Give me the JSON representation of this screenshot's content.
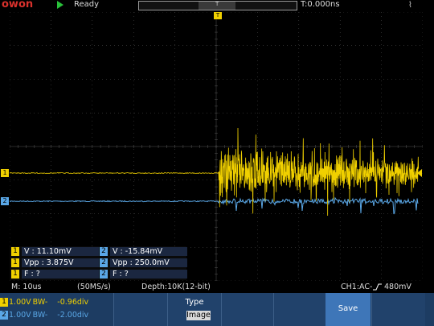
{
  "header": {
    "brand": "owon",
    "status": "Ready",
    "trigger_time": "T:0.000ns",
    "trigger_mark": "T",
    "usb_symbol": "⌇"
  },
  "markers": {
    "ch1": "1",
    "ch2": "2",
    "trigger_top": "T"
  },
  "measurements": [
    {
      "channel": "1",
      "text": "V : 11.10mV"
    },
    {
      "channel": "2",
      "text": "V : -15.84mV"
    },
    {
      "channel": "1",
      "text": "Vpp : 3.875V"
    },
    {
      "channel": "2",
      "text": "Vpp : 250.0mV"
    },
    {
      "channel": "1",
      "text": "F :    ?"
    },
    {
      "channel": "2",
      "text": "F :    ?"
    }
  ],
  "info": {
    "timebase": "M: 10us",
    "sample_rate": "(50MS/s)",
    "depth": "Depth:10K(12-bit)",
    "trigger": "CH1:AC-",
    "trigger_level": "480mV"
  },
  "channels": [
    {
      "badge": "1",
      "scale": "1.00V",
      "bw": "BW-",
      "offset": "-0.96div",
      "color": "#f0d000"
    },
    {
      "badge": "2",
      "scale": "1.00V",
      "bw": "BW-",
      "offset": "-2.00div",
      "color": "#5aa7e6"
    }
  ],
  "menu": {
    "type_label": "Type",
    "type_value": "Image",
    "save_label": "Save"
  },
  "colors": {
    "ch1": "#f0d000",
    "ch2": "#5aa7e6",
    "menu_bg": "#1d3c62",
    "save_bg": "#3e76b8"
  }
}
